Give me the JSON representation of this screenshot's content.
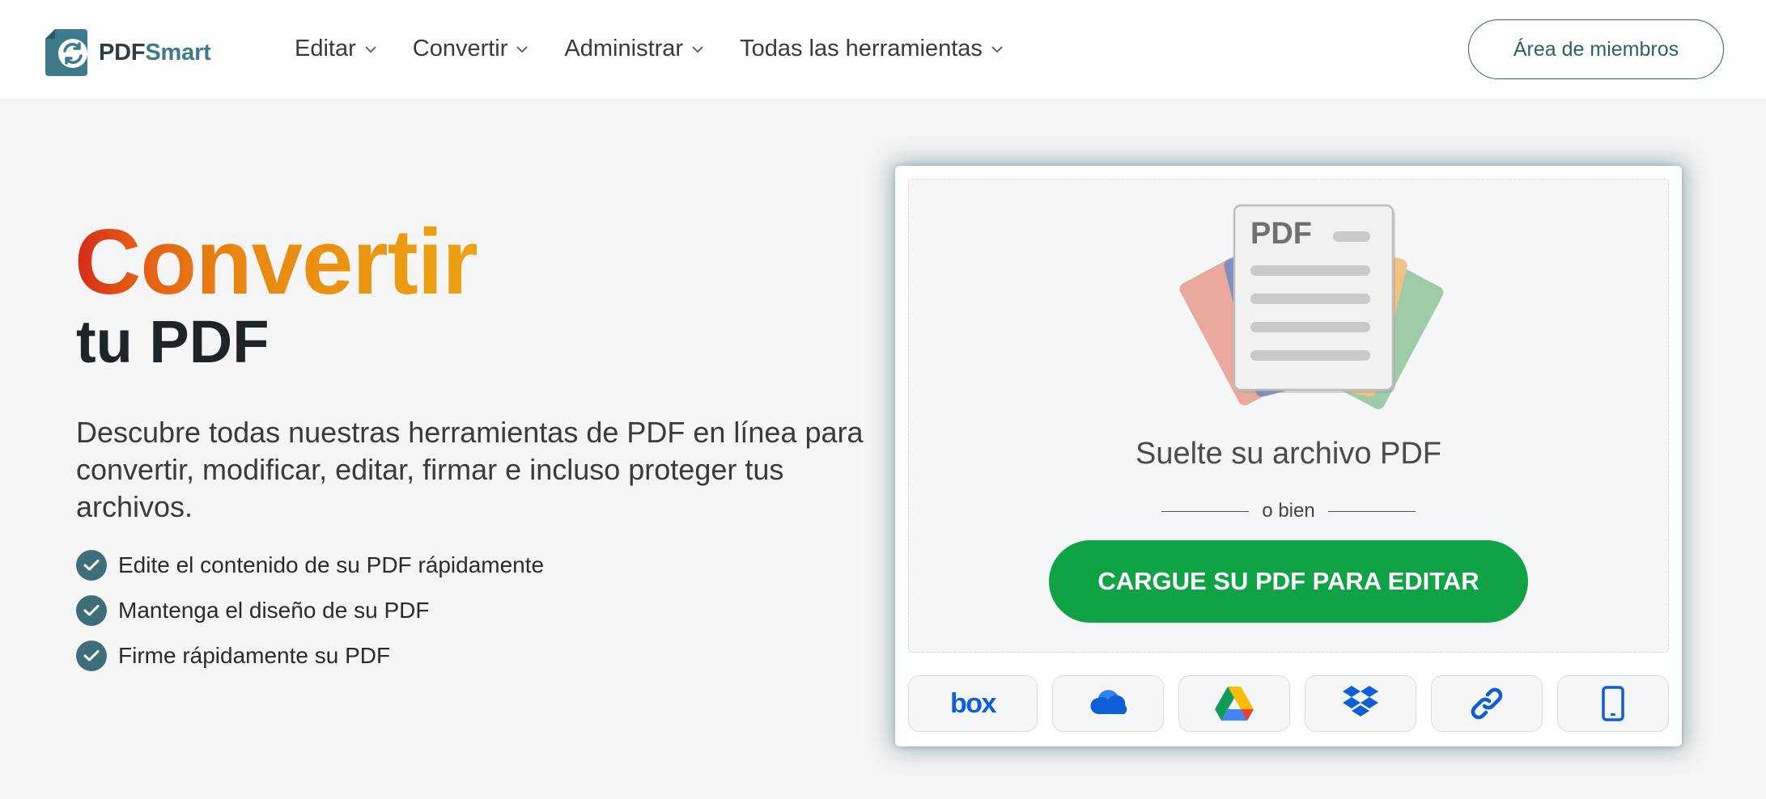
{
  "header": {
    "logo": {
      "brand_part1": "PDF",
      "brand_part2": "Smart"
    },
    "nav": [
      {
        "label": "Editar"
      },
      {
        "label": "Convertir"
      },
      {
        "label": "Administrar"
      },
      {
        "label": "Todas las herramientas"
      }
    ],
    "member_button": "Área de miembros"
  },
  "hero": {
    "title_line1": "Convertir",
    "title_line2": "tu PDF",
    "description": "Descubre todas nuestras herramientas de PDF en línea para convertir, modificar, editar, firmar e incluso proteger tus archivos.",
    "features": [
      {
        "label": "Edite el contenido de su PDF rápidamente"
      },
      {
        "label": "Mantenga el diseño de su PDF"
      },
      {
        "label": "Firme rápidamente su PDF"
      }
    ]
  },
  "upload": {
    "illustration_label": "PDF",
    "drop_title": "Suelte su archivo PDF",
    "or_text": "o bien",
    "button_label": "CARGUE SU PDF PARA EDITAR",
    "sources": [
      {
        "label": "box",
        "icon": "box-icon"
      },
      {
        "icon": "onedrive-icon"
      },
      {
        "icon": "google-drive-icon"
      },
      {
        "icon": "dropbox-icon"
      },
      {
        "icon": "link-icon"
      },
      {
        "icon": "mobile-device-icon"
      }
    ]
  },
  "colors": {
    "brand_teal": "#3f7a8a",
    "member_button_border": "#2e5e6b",
    "title_gradient_start": "#d42a1a",
    "title_gradient_end": "#eba313",
    "check_circle": "#3d6e7a",
    "upload_button": "#0fa345",
    "cloud_icon_blue": "#0f5ed7"
  }
}
